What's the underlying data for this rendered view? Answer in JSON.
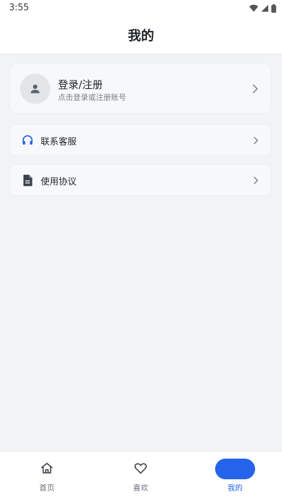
{
  "status_bar": {
    "time": "3:55"
  },
  "header": {
    "title": "我的"
  },
  "login_card": {
    "title": "登录/注册",
    "subtitle": "点击登录或注册账号"
  },
  "menu": [
    {
      "label": "联系客服",
      "icon": "headset-icon"
    },
    {
      "label": "使用协议",
      "icon": "document-icon"
    }
  ],
  "tabs": [
    {
      "label": "首页",
      "icon": "home-icon",
      "active": false
    },
    {
      "label": "喜欢",
      "icon": "heart-icon",
      "active": false
    },
    {
      "label": "我的",
      "icon": "profile-icon",
      "active": true
    }
  ],
  "colors": {
    "accent": "#2563eb",
    "background": "#f2f3f5",
    "card": "#f7f8fa"
  }
}
